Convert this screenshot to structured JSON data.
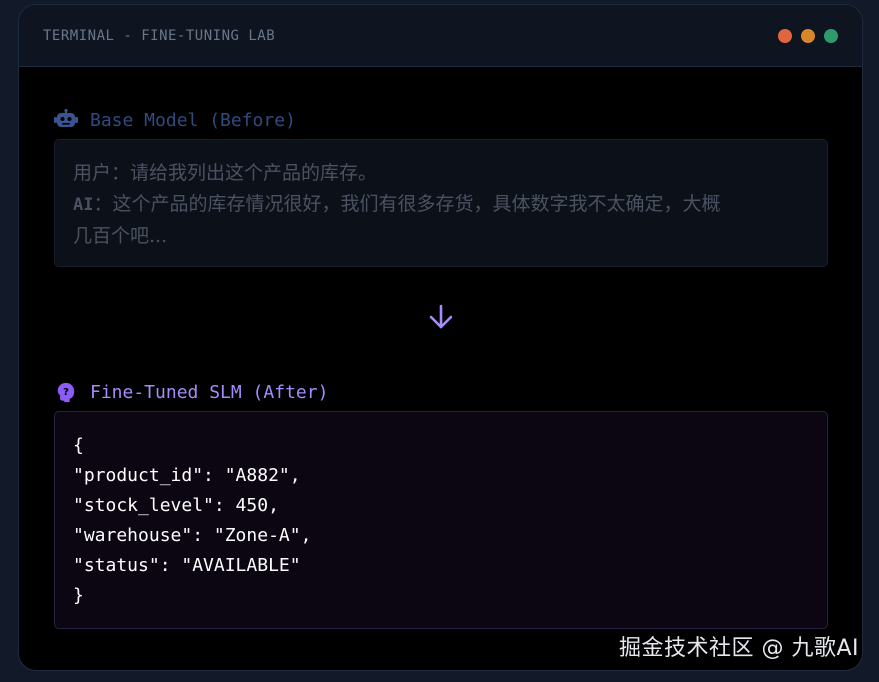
{
  "window": {
    "title": "TERMINAL - FINE-TUNING LAB",
    "dots": [
      {
        "name": "close",
        "color": "#e0663f"
      },
      {
        "name": "minimize",
        "color": "#d9862a"
      },
      {
        "name": "maximize",
        "color": "#2f9a6c"
      }
    ]
  },
  "before": {
    "icon": "robot-icon",
    "heading": "Base Model (Before)",
    "user_speaker": "用户",
    "user_sep": "：",
    "user_text": "请给我列出这个产品的库存。",
    "ai_speaker": "AI",
    "ai_sep": "：",
    "ai_text_line1": "这个产品的库存情况很好，我们有很多存货，具体数字我不太确定，大概",
    "ai_text_line2": "几百个吧..."
  },
  "arrow": {
    "icon": "arrow-down-icon",
    "color": "#a78bfa"
  },
  "after": {
    "icon": "brain-icon",
    "heading": "Fine-Tuned SLM (After)",
    "code_lines": [
      "{",
      "\"product_id\": \"A882\",",
      "\"stock_level\": 450,",
      "\"warehouse\": \"Zone-A\",",
      "\"status\": \"AVAILABLE\"",
      "}"
    ]
  },
  "watermark": "掘金技术社区 @ 九歌AI"
}
